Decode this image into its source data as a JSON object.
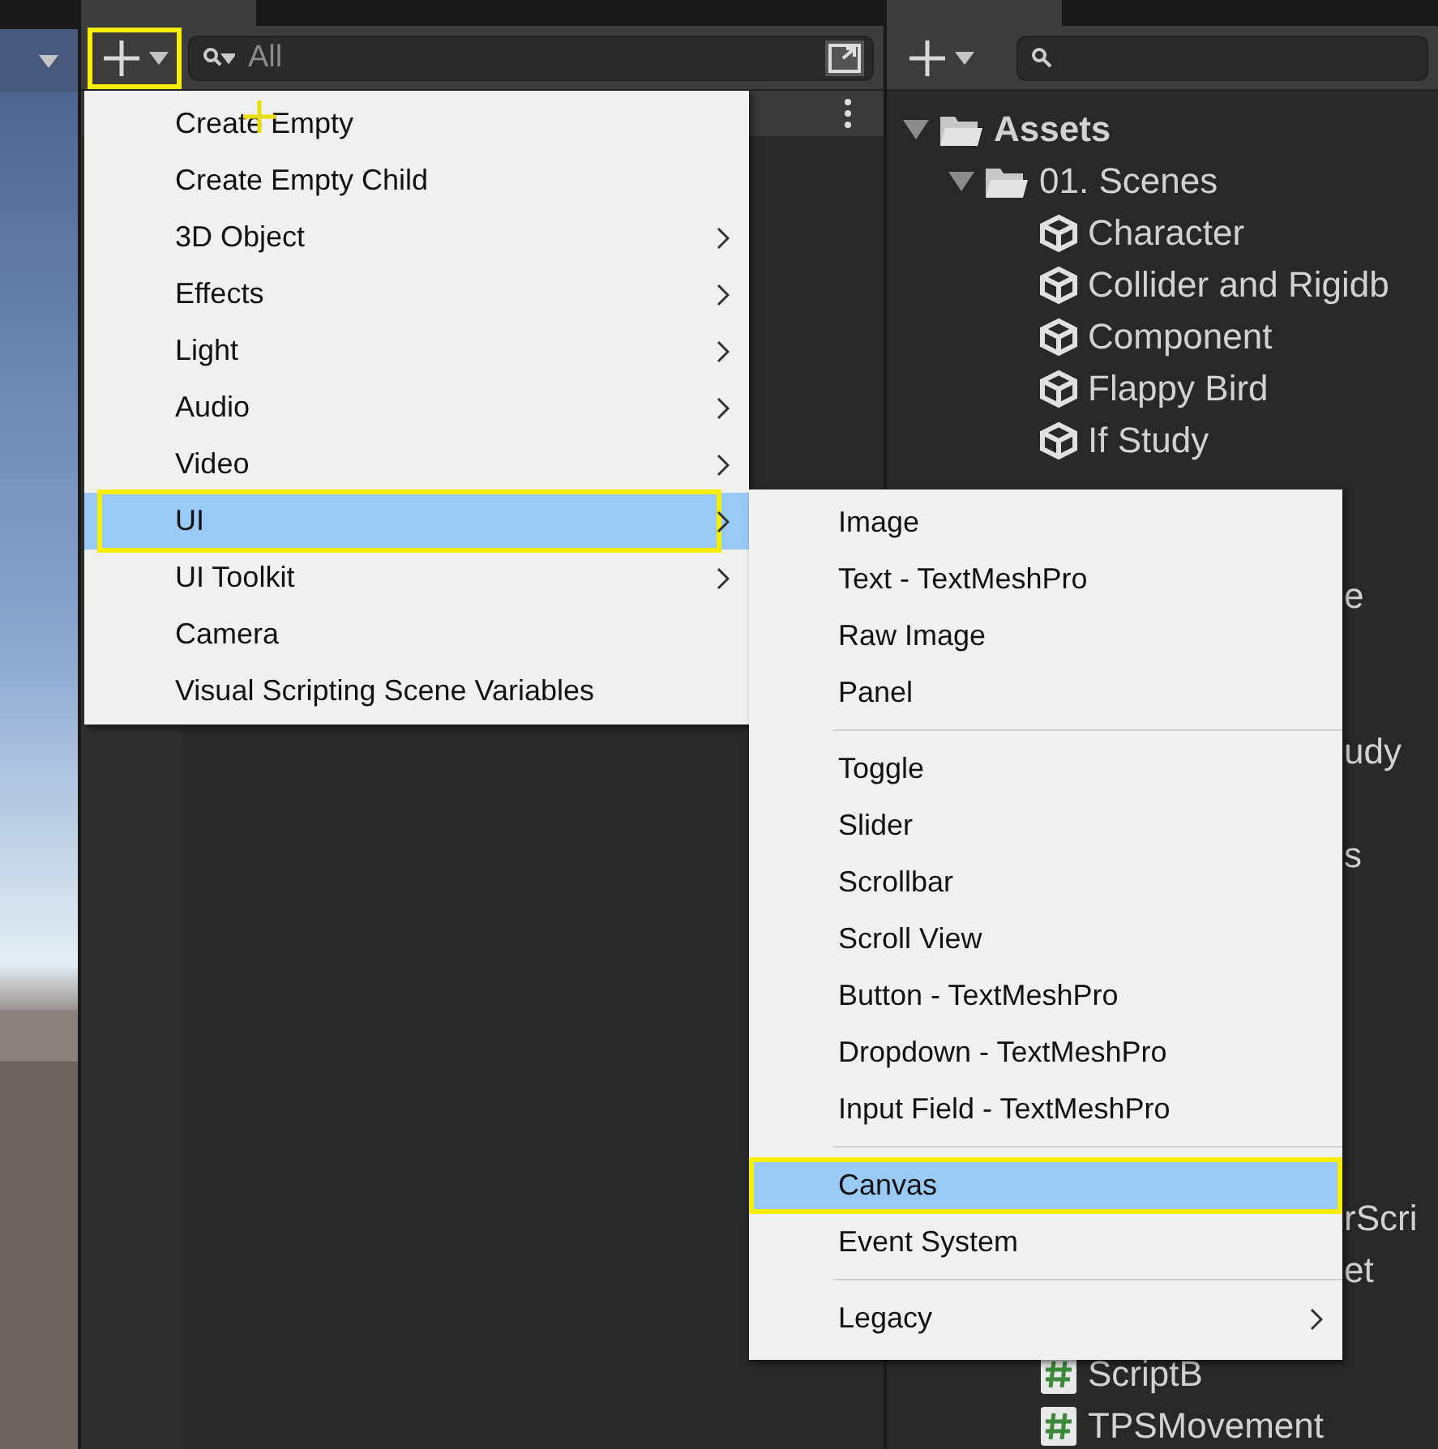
{
  "hierarchy": {
    "add_button": {
      "highlighted": true
    },
    "search": {
      "placeholder": "All"
    }
  },
  "project": {
    "tree": [
      {
        "kind": "folder",
        "name": "Assets",
        "expanded": true,
        "children": [
          {
            "kind": "folder",
            "name": "01. Scenes",
            "expanded": true,
            "children": [
              {
                "kind": "scene",
                "name": "Character"
              },
              {
                "kind": "scene",
                "name": "Collider and Rigidb"
              },
              {
                "kind": "scene",
                "name": "Component"
              },
              {
                "kind": "scene",
                "name": "Flappy Bird"
              },
              {
                "kind": "scene",
                "name": "If Study"
              },
              {
                "kind": "covered"
              },
              {
                "kind": "covered"
              },
              {
                "kind": "fragment",
                "name": "e"
              },
              {
                "kind": "covered"
              },
              {
                "kind": "covered"
              },
              {
                "kind": "fragment",
                "name": "udy"
              },
              {
                "kind": "covered"
              },
              {
                "kind": "fragment",
                "name": "s"
              },
              {
                "kind": "covered"
              },
              {
                "kind": "covered"
              },
              {
                "kind": "covered"
              },
              {
                "kind": "covered"
              },
              {
                "kind": "covered"
              },
              {
                "kind": "covered"
              },
              {
                "kind": "fragment",
                "name": "rScri"
              },
              {
                "kind": "fragment",
                "name": "et"
              },
              {
                "kind": "covered"
              },
              {
                "kind": "script",
                "name": "ScriptB"
              },
              {
                "kind": "script",
                "name": "TPSMovement"
              }
            ]
          }
        ]
      }
    ]
  },
  "menu": [
    {
      "kind": "item",
      "label": "Create Empty",
      "submenu": false,
      "selected": false,
      "highlighted": false
    },
    {
      "kind": "item",
      "label": "Create Empty Child",
      "submenu": false,
      "selected": false,
      "highlighted": false
    },
    {
      "kind": "item",
      "label": "3D Object",
      "submenu": true,
      "selected": false,
      "highlighted": false
    },
    {
      "kind": "item",
      "label": "Effects",
      "submenu": true,
      "selected": false,
      "highlighted": false
    },
    {
      "kind": "item",
      "label": "Light",
      "submenu": true,
      "selected": false,
      "highlighted": false
    },
    {
      "kind": "item",
      "label": "Audio",
      "submenu": true,
      "selected": false,
      "highlighted": false
    },
    {
      "kind": "item",
      "label": "Video",
      "submenu": true,
      "selected": false,
      "highlighted": false
    },
    {
      "kind": "item",
      "label": "UI",
      "submenu": true,
      "selected": true,
      "highlighted": true
    },
    {
      "kind": "item",
      "label": "UI Toolkit",
      "submenu": true,
      "selected": false,
      "highlighted": false
    },
    {
      "kind": "item",
      "label": "Camera",
      "submenu": false,
      "selected": false,
      "highlighted": false
    },
    {
      "kind": "item",
      "label": "Visual Scripting Scene Variables",
      "submenu": false,
      "selected": false,
      "highlighted": false
    }
  ],
  "submenu": [
    {
      "kind": "item",
      "label": "Image",
      "submenu": false,
      "selected": false,
      "highlighted": false
    },
    {
      "kind": "item",
      "label": "Text - TextMeshPro",
      "submenu": false,
      "selected": false,
      "highlighted": false
    },
    {
      "kind": "item",
      "label": "Raw Image",
      "submenu": false,
      "selected": false,
      "highlighted": false
    },
    {
      "kind": "item",
      "label": "Panel",
      "submenu": false,
      "selected": false,
      "highlighted": false
    },
    {
      "kind": "separator"
    },
    {
      "kind": "item",
      "label": "Toggle",
      "submenu": false,
      "selected": false,
      "highlighted": false
    },
    {
      "kind": "item",
      "label": "Slider",
      "submenu": false,
      "selected": false,
      "highlighted": false
    },
    {
      "kind": "item",
      "label": "Scrollbar",
      "submenu": false,
      "selected": false,
      "highlighted": false
    },
    {
      "kind": "item",
      "label": "Scroll View",
      "submenu": false,
      "selected": false,
      "highlighted": false
    },
    {
      "kind": "item",
      "label": "Button - TextMeshPro",
      "submenu": false,
      "selected": false,
      "highlighted": false
    },
    {
      "kind": "item",
      "label": "Dropdown - TextMeshPro",
      "submenu": false,
      "selected": false,
      "highlighted": false
    },
    {
      "kind": "item",
      "label": "Input Field - TextMeshPro",
      "submenu": false,
      "selected": false,
      "highlighted": false
    },
    {
      "kind": "separator"
    },
    {
      "kind": "item",
      "label": "Canvas",
      "submenu": false,
      "selected": true,
      "highlighted": true
    },
    {
      "kind": "item",
      "label": "Event System",
      "submenu": false,
      "selected": false,
      "highlighted": false
    },
    {
      "kind": "separator"
    },
    {
      "kind": "item",
      "label": "Legacy",
      "submenu": true,
      "selected": false,
      "highlighted": false
    }
  ]
}
